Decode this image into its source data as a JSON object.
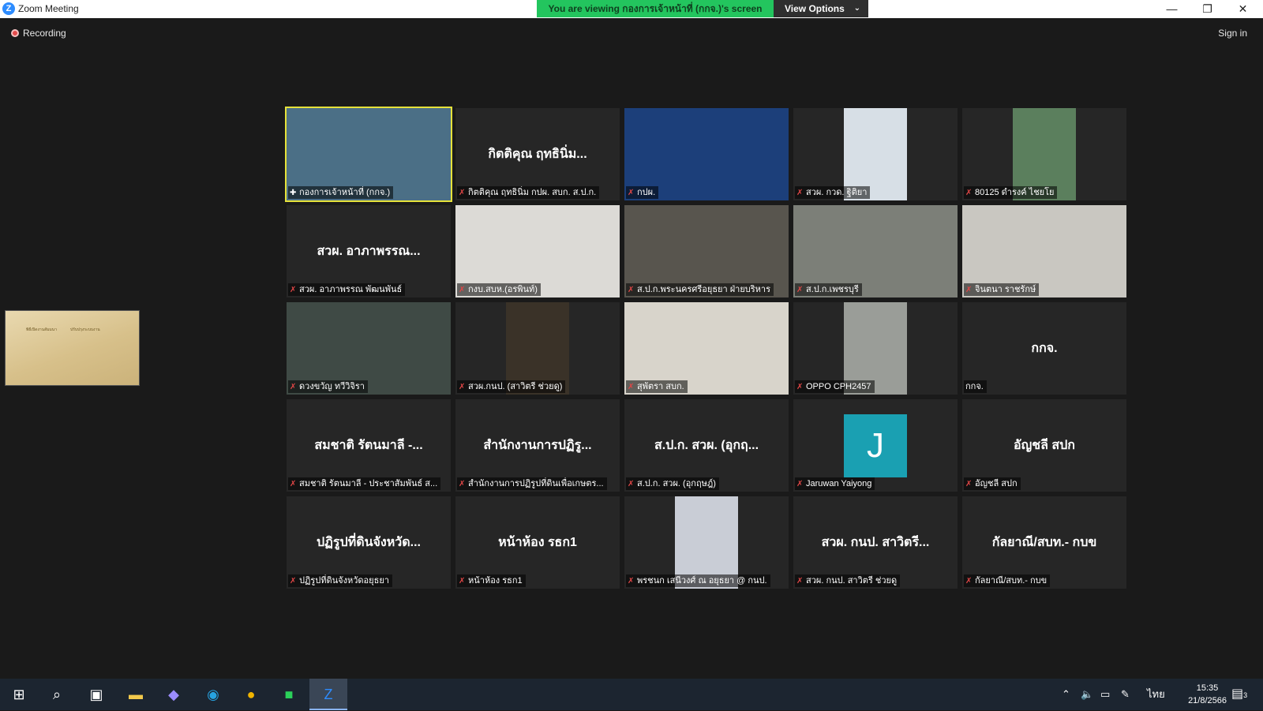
{
  "titlebar": {
    "app_title": "Zoom Meeting",
    "logo_letter": "Z",
    "viewing_banner": "You are viewing กองการเจ้าหน้าที่ (กกจ.)'s screen",
    "view_options": "View Options",
    "view_options_icon": "chevron-down-icon",
    "minimize_icon": "minimize-icon",
    "maximize_icon": "restore-icon",
    "close_icon": "close-icon"
  },
  "meeting": {
    "recording_label": "Recording",
    "sign_in_label": "Sign in",
    "shared_screen_text_1": "พิธีเปิดงานสัมมนา",
    "shared_screen_text_2": "ปรับปรุงระบบงาน"
  },
  "participants": [
    {
      "name": "กองการเจ้าหน้าที่ (กกจ.)",
      "display": "",
      "type": "video",
      "bg": "#4b6f86",
      "active": true,
      "pin": true
    },
    {
      "name": "กิตติคุณ ฤทธินิ่ม กปผ. สบก. ส.ป.ก.",
      "display": "กิตติคุณ ฤทธินิ่ม...",
      "type": "name"
    },
    {
      "name": "กปผ.",
      "display": "",
      "type": "video",
      "bg": "#1c3f7a"
    },
    {
      "name": "สวผ. กวด. ฐิติยา",
      "display": "",
      "type": "video",
      "bg": "#d7dfe6"
    },
    {
      "name": "80125 ดำรงค์ ไชยโย",
      "display": "",
      "type": "video",
      "bg": "#5b7f5d"
    },
    {
      "name": "สวผ. อาภาพรรณ พัฒนพันธ์",
      "display": "สวผ. อาภาพรรณ...",
      "type": "name"
    },
    {
      "name": "กงบ.สบห.(อรพินท์)",
      "display": "",
      "type": "video",
      "bg": "#dcdad6"
    },
    {
      "name": "ส.ป.ก.พระนครศรีอยุธยา ฝ่ายบริหาร",
      "display": "",
      "type": "video",
      "bg": "#58554e"
    },
    {
      "name": "ส.ป.ก.เพชรบุรี",
      "display": "",
      "type": "video",
      "bg": "#7c7f78"
    },
    {
      "name": "จินตนา ราชรักษ์",
      "display": "",
      "type": "video",
      "bg": "#c9c7c1"
    },
    {
      "name": "ดวงขวัญ ทวีวิจิรา",
      "display": "",
      "type": "video",
      "bg": "#3f4a45"
    },
    {
      "name": "สวผ.กนป. (สาวิตรี ช่วยดู)",
      "display": "",
      "type": "video",
      "bg": "#3a3228"
    },
    {
      "name": "สุพัตรา สบก.",
      "display": "",
      "type": "video",
      "bg": "#d8d4cb"
    },
    {
      "name": "OPPO CPH2457",
      "display": "",
      "type": "video",
      "bg": "#9a9d98"
    },
    {
      "name": "กกจ.",
      "display": "กกจ.",
      "type": "name"
    },
    {
      "name": "สมชาติ รัตนมาลี - ประชาสัมพันธ์ ส...",
      "display": "สมชาติ รัตนมาลี -...",
      "type": "name"
    },
    {
      "name": "สำนักงานการปฏิรูปที่ดินเพื่อเกษตร...",
      "display": "สำนักงานการปฏิรู...",
      "type": "name"
    },
    {
      "name": "ส.ป.ก. สวผ. (อุกฤษฎ์)",
      "display": "ส.ป.ก. สวผ. (อุกฤ...",
      "type": "name"
    },
    {
      "name": "Jaruwan Yaiyong",
      "display": "J",
      "type": "avatar"
    },
    {
      "name": "อัญชลี สปก",
      "display": "อัญชลี สปก",
      "type": "name"
    },
    {
      "name": "ปฏิรูปที่ดินจังหวัดอยุธยา",
      "display": "ปฏิรูปที่ดินจังหวัด...",
      "type": "name"
    },
    {
      "name": "หน้าห้อง รธก1",
      "display": "หน้าห้อง รธก1",
      "type": "name"
    },
    {
      "name": "พรชนก เสนีวงศ์ ณ อยุธยา @ กนป.",
      "display": "",
      "type": "video",
      "bg": "#c9cdd6"
    },
    {
      "name": "สวผ. กนป. สาวิตรี ช่วยดู",
      "display": "สวผ. กนป. สาวิตรี...",
      "type": "name"
    },
    {
      "name": "กัลยาณี/สบท.- กบข",
      "display": "กัลยาณี/สบท.- กบข",
      "type": "name"
    }
  ],
  "taskbar": {
    "apps": [
      "windows-start-icon",
      "search-icon",
      "task-view-icon",
      "file-explorer-icon",
      "copilot-icon",
      "edge-icon",
      "chrome-icon",
      "line-icon",
      "zoom-icon"
    ],
    "language": "ไทย",
    "time": "15:35",
    "date": "21/8/2566",
    "notifications": "3"
  }
}
